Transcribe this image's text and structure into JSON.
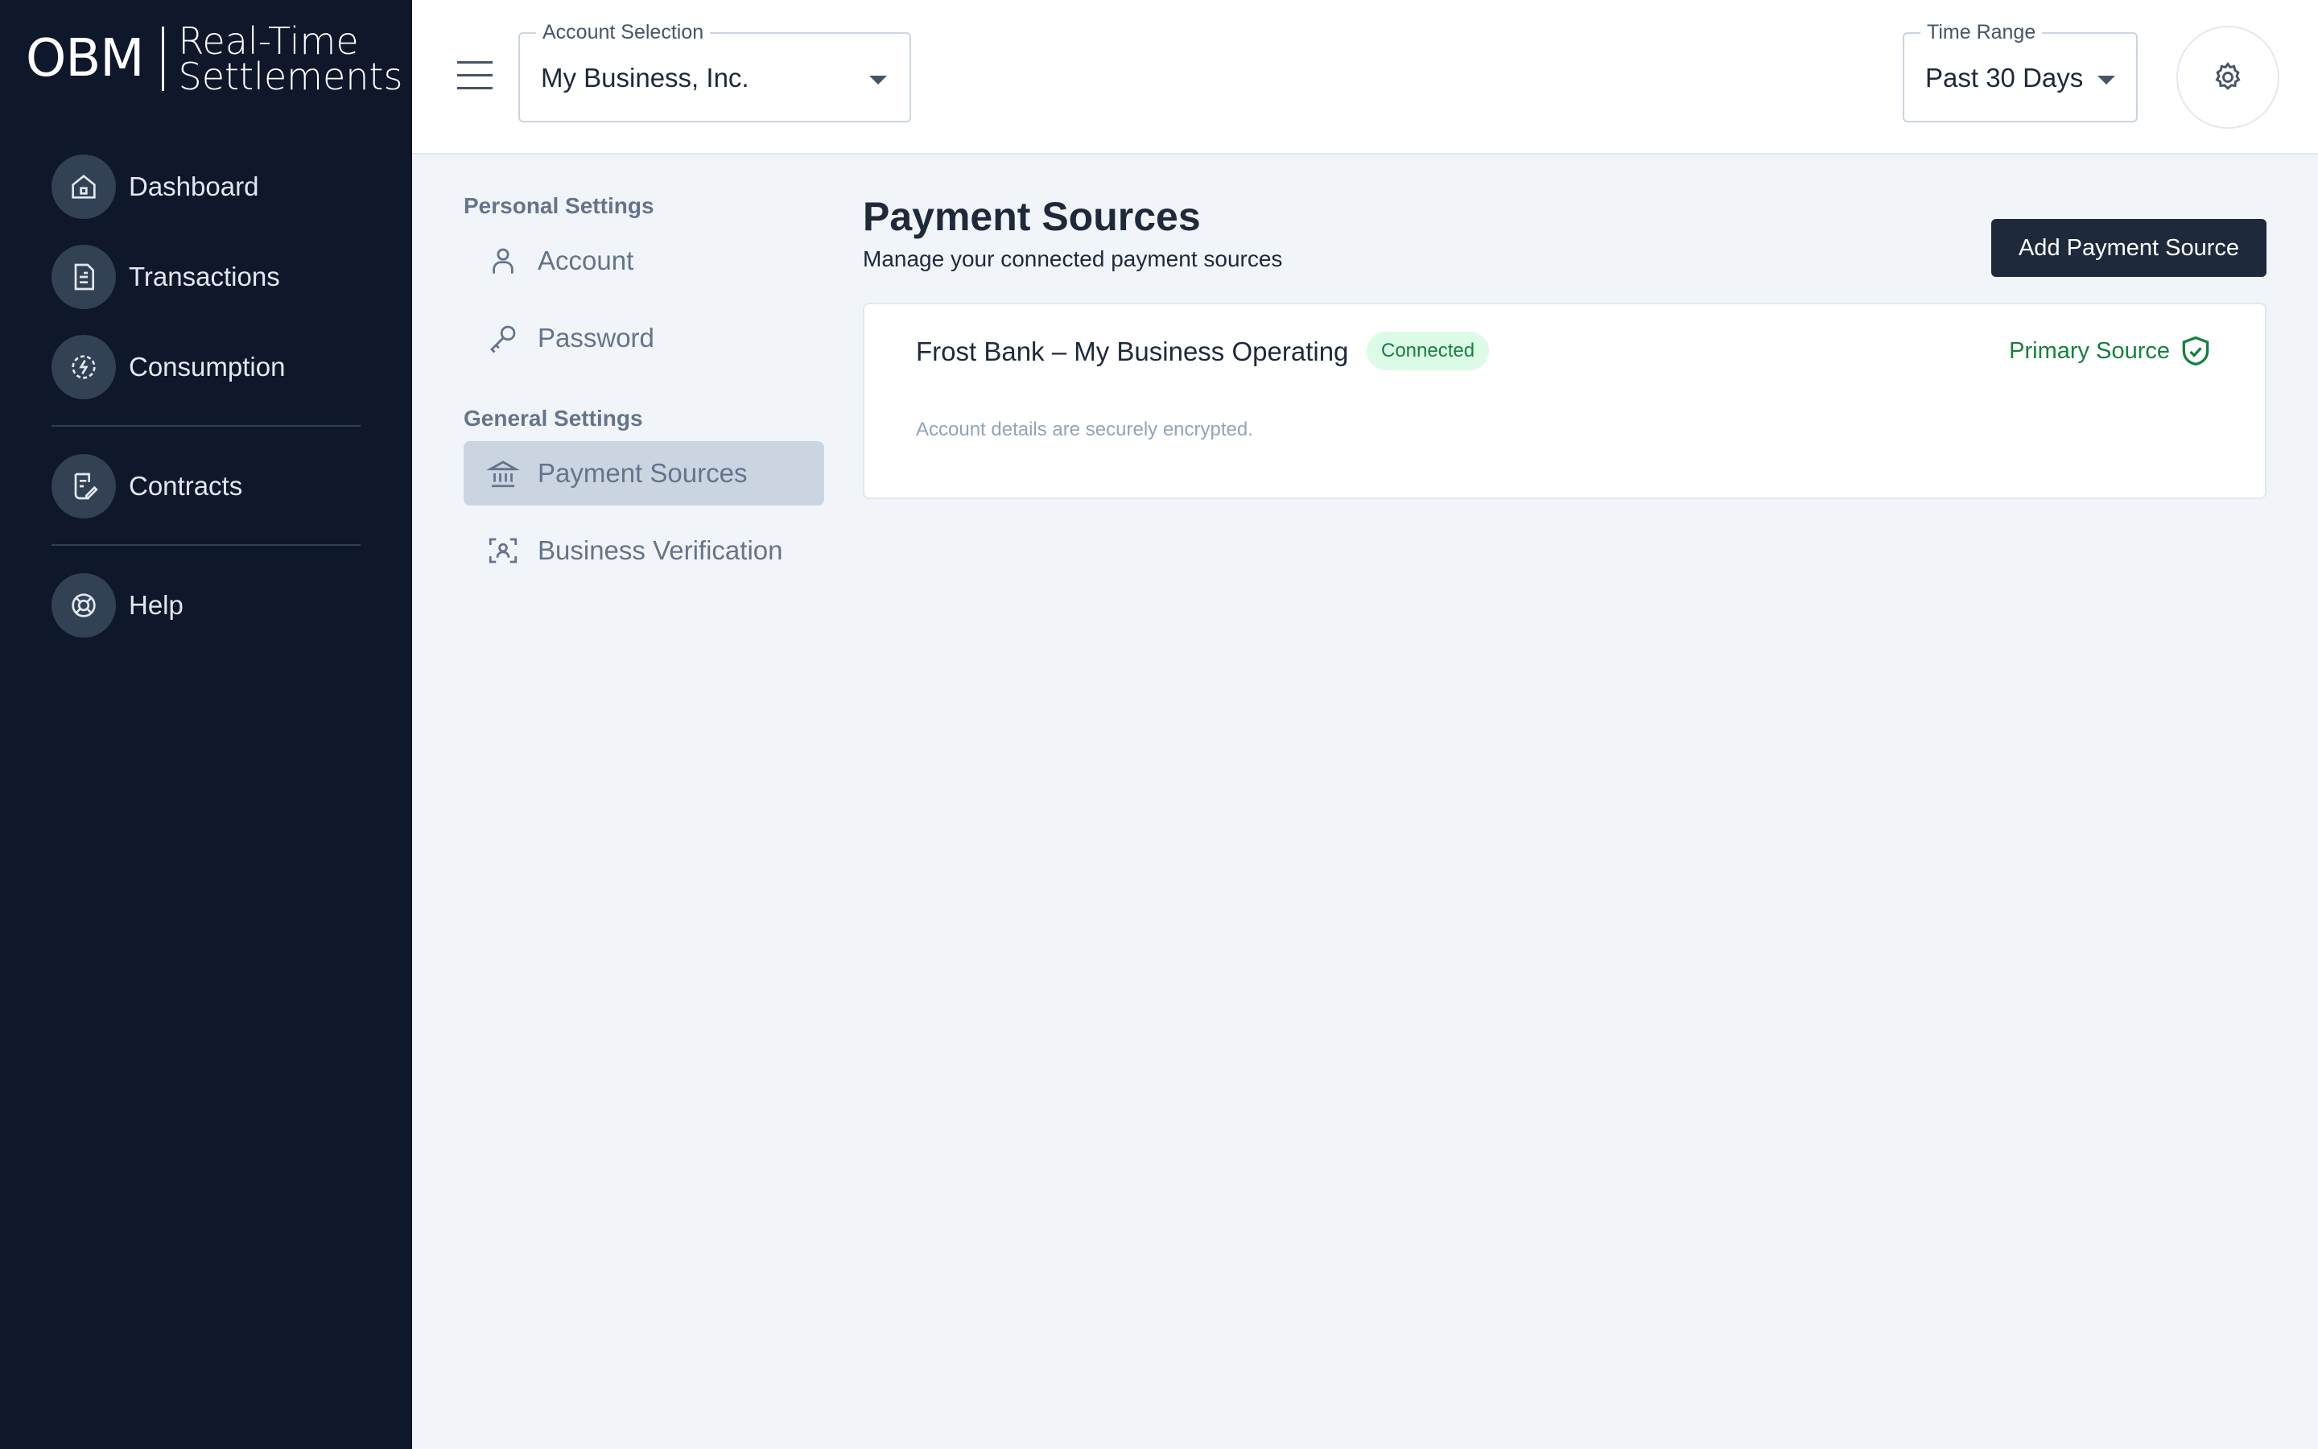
{
  "brand": {
    "mark": "OBM",
    "line1": "Real-Time",
    "line2": "Settlements"
  },
  "sidebar": {
    "items": [
      {
        "label": "Dashboard",
        "icon": "home-icon"
      },
      {
        "label": "Transactions",
        "icon": "document-icon"
      },
      {
        "label": "Consumption",
        "icon": "energy-icon"
      },
      {
        "label": "Contracts",
        "icon": "contract-icon"
      },
      {
        "label": "Help",
        "icon": "lifebuoy-icon"
      }
    ]
  },
  "header": {
    "account": {
      "legend": "Account Selection",
      "value": "My Business, Inc."
    },
    "time_range": {
      "legend": "Time Range",
      "value": "Past 30 Days"
    }
  },
  "settings_nav": {
    "personal_title": "Personal Settings",
    "personal_items": [
      {
        "label": "Account",
        "icon": "user-icon"
      },
      {
        "label": "Password",
        "icon": "key-icon"
      }
    ],
    "general_title": "General Settings",
    "general_items": [
      {
        "label": "Payment Sources",
        "icon": "bank-icon",
        "active": true
      },
      {
        "label": "Business Verification",
        "icon": "face-scan-icon",
        "active": false
      }
    ]
  },
  "main": {
    "title": "Payment Sources",
    "subtitle": "Manage your connected payment sources",
    "add_button": "Add Payment Source",
    "sources": [
      {
        "name": "Frost Bank – My Business Operating",
        "status": "Connected",
        "primary_label": "Primary Source",
        "note": "Account details are securely encrypted."
      }
    ]
  },
  "colors": {
    "sidebar_bg": "#0f172a",
    "accent_dark": "#1e293b",
    "success": "#15803d",
    "success_bg": "#dcfce7",
    "page_bg": "#f1f5f9"
  }
}
